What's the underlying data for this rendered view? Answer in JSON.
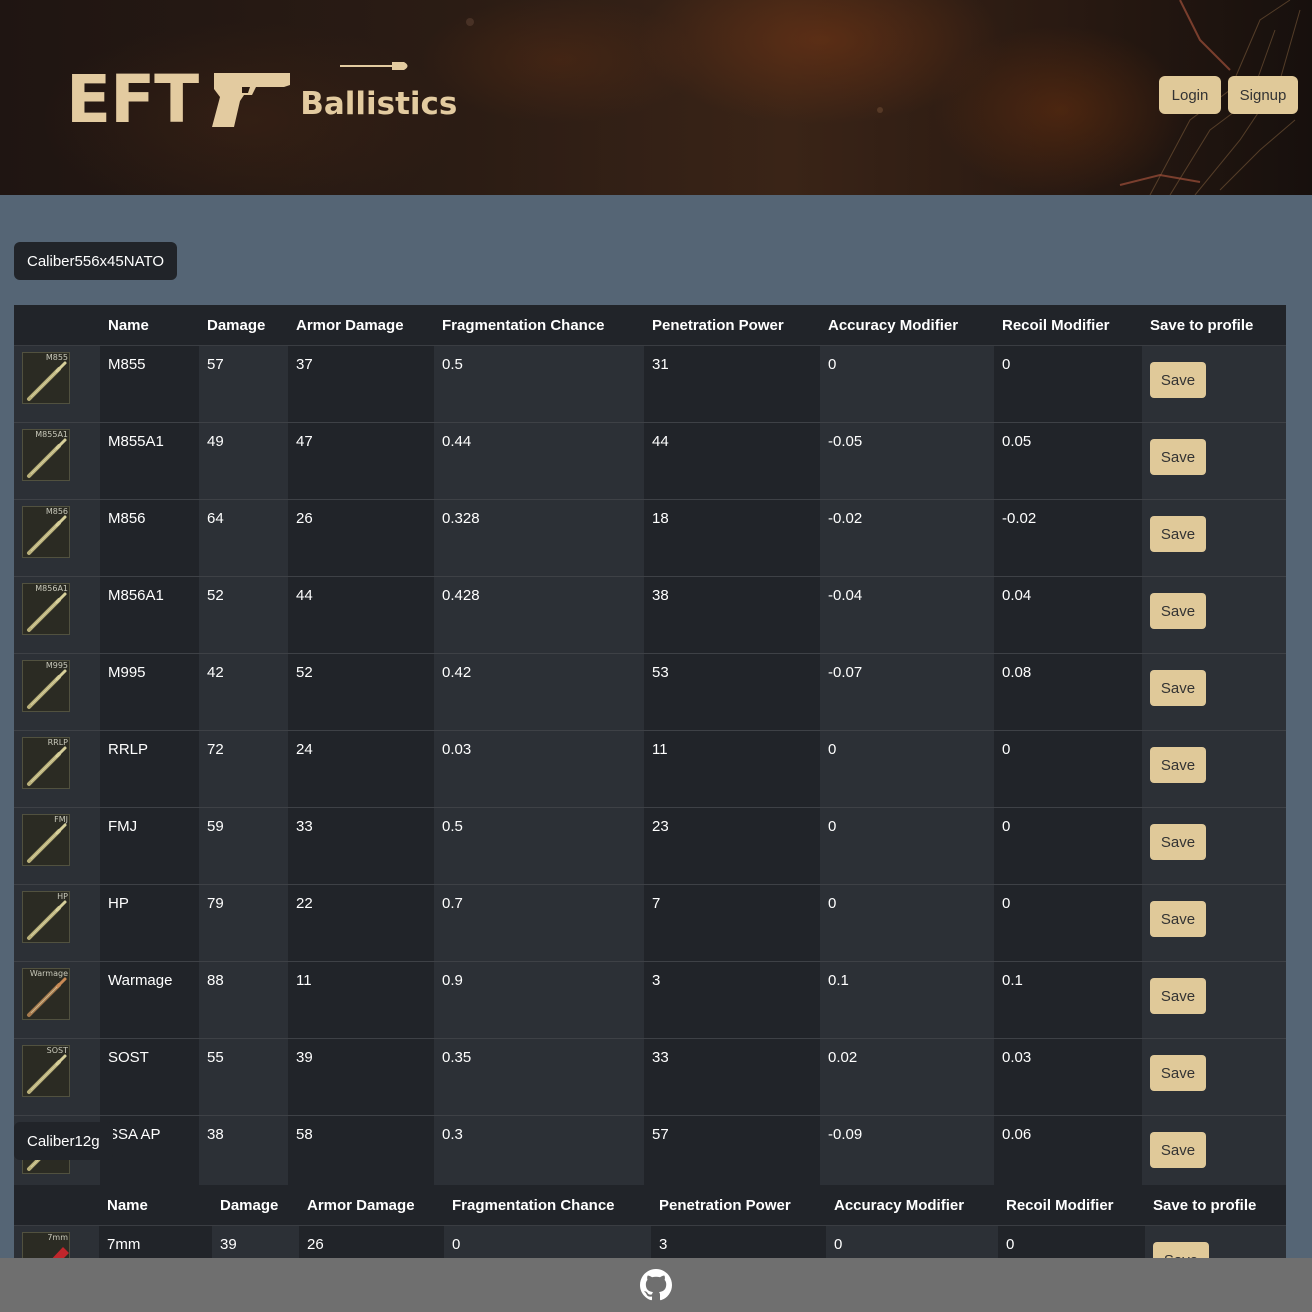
{
  "header": {
    "logo_text": "EFT",
    "logo_subtitle": "Ballistics",
    "login_label": "Login",
    "signup_label": "Signup"
  },
  "colors": {
    "accent": "#e0c999",
    "page_bg": "#556575",
    "table_bg": "#212429",
    "footer_bg": "#6f6f6f"
  },
  "columns": [
    "",
    "Name",
    "Damage",
    "Armor Damage",
    "Fragmentation Chance",
    "Penetration Power",
    "Accuracy Modifier",
    "Recoil Modifier",
    "Save to profile"
  ],
  "save_label": "Save",
  "calibers": [
    {
      "name": "Caliber556x45NATO",
      "ammo": [
        {
          "tag": "M855",
          "name": "M855",
          "damage": "57",
          "armor_damage": "37",
          "frag": "0.5",
          "pen": "31",
          "acc": "0",
          "recoil": "0",
          "icon": "brass-rifle-round-icon"
        },
        {
          "tag": "M855A1",
          "name": "M855A1",
          "damage": "49",
          "armor_damage": "47",
          "frag": "0.44",
          "pen": "44",
          "acc": "-0.05",
          "recoil": "0.05",
          "icon": "brass-rifle-round-icon"
        },
        {
          "tag": "M856",
          "name": "M856",
          "damage": "64",
          "armor_damage": "26",
          "frag": "0.328",
          "pen": "18",
          "acc": "-0.02",
          "recoil": "-0.02",
          "icon": "brass-rifle-round-icon"
        },
        {
          "tag": "M856A1",
          "name": "M856A1",
          "damage": "52",
          "armor_damage": "44",
          "frag": "0.428",
          "pen": "38",
          "acc": "-0.04",
          "recoil": "0.04",
          "icon": "brass-rifle-round-icon"
        },
        {
          "tag": "M995",
          "name": "M995",
          "damage": "42",
          "armor_damage": "52",
          "frag": "0.42",
          "pen": "53",
          "acc": "-0.07",
          "recoil": "0.08",
          "icon": "brass-rifle-round-icon"
        },
        {
          "tag": "RRLP",
          "name": "RRLP",
          "damage": "72",
          "armor_damage": "24",
          "frag": "0.03",
          "pen": "11",
          "acc": "0",
          "recoil": "0",
          "icon": "brass-rifle-round-icon"
        },
        {
          "tag": "FMJ",
          "name": "FMJ",
          "damage": "59",
          "armor_damage": "33",
          "frag": "0.5",
          "pen": "23",
          "acc": "0",
          "recoil": "0",
          "icon": "brass-rifle-round-icon"
        },
        {
          "tag": "HP",
          "name": "HP",
          "damage": "79",
          "armor_damage": "22",
          "frag": "0.7",
          "pen": "7",
          "acc": "0",
          "recoil": "0",
          "icon": "brass-rifle-round-icon"
        },
        {
          "tag": "Warmage",
          "name": "Warmage",
          "damage": "88",
          "armor_damage": "11",
          "frag": "0.9",
          "pen": "3",
          "acc": "0.1",
          "recoil": "0.1",
          "icon": "copper-rifle-round-icon"
        },
        {
          "tag": "SOST",
          "name": "SOST",
          "damage": "55",
          "armor_damage": "39",
          "frag": "0.35",
          "pen": "33",
          "acc": "0.02",
          "recoil": "0.03",
          "icon": "brass-rifle-round-icon"
        },
        {
          "tag": "SSA AP",
          "name": "SSA AP",
          "damage": "38",
          "armor_damage": "58",
          "frag": "0.3",
          "pen": "57",
          "acc": "-0.09",
          "recoil": "0.06",
          "icon": "brass-rifle-round-icon"
        }
      ]
    },
    {
      "name": "Caliber12g",
      "ammo": [
        {
          "tag": "7mm",
          "name": "7mm",
          "damage": "39",
          "armor_damage": "26",
          "frag": "0",
          "pen": "3",
          "acc": "0",
          "recoil": "0",
          "icon": "red-shotgun-shell-icon"
        }
      ]
    }
  ],
  "footer": {
    "icon": "github-icon"
  }
}
